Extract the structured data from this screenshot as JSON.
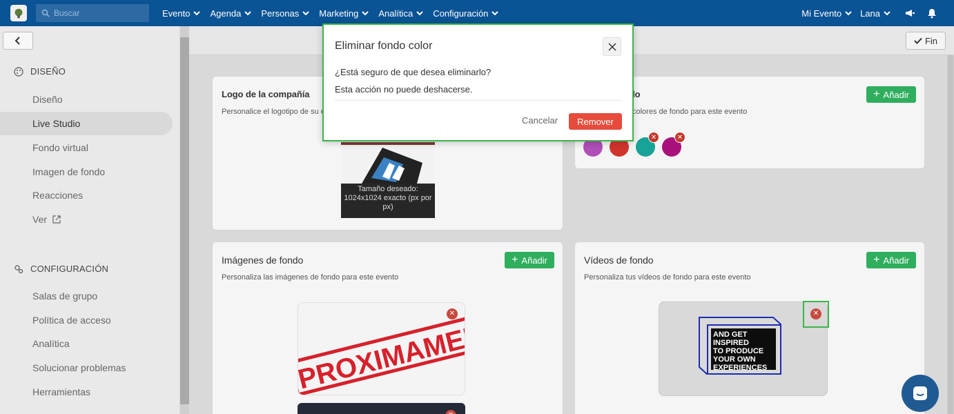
{
  "topbar": {
    "search_placeholder": "Buscar",
    "nav": [
      "Evento",
      "Agenda",
      "Personas",
      "Marketing",
      "Analítica",
      "Configuración"
    ],
    "event_menu": "Mi Evento",
    "user_menu": "Lana",
    "bg_color": "#0a5394"
  },
  "sidebar": {
    "section_design": "DISEÑO",
    "design_items": [
      "Diseño",
      "Live Studio",
      "Fondo virtual",
      "Imagen de fondo",
      "Reacciones",
      "Ver"
    ],
    "active_item": "Live Studio",
    "section_config": "CONFIGURACIÓN",
    "config_items": [
      "Salas de grupo",
      "Política de acceso",
      "Analítica",
      "Solucionar problemas",
      "Herramientas"
    ]
  },
  "main": {
    "fin_label": "Fin",
    "cards": {
      "logo": {
        "title": "Logo de la compañía",
        "subtitle": "Personalice el logotipo de su e",
        "caption": "Tamaño deseado: 1024x1024 exacto (px por px)"
      },
      "colors": {
        "title": "ndo",
        "subtitle": "colores de fondo para este evento",
        "add_label": "Añadir",
        "swatches": [
          "#b04fb8",
          "#d0342c",
          "#17a398",
          "#a8127a"
        ]
      },
      "images": {
        "title": "Imágenes de fondo",
        "subtitle": "Personaliza las imágenes de fondo para este evento",
        "add_label": "Añadir",
        "stamp_text": "PROXIMAMENTE"
      },
      "videos": {
        "title": "Vídeos de fondo",
        "subtitle": "Personaliza tus vídeos de fondo para este evento",
        "add_label": "Añadir",
        "video_text": "AND GET INSPIRED TO PRODUCE YOUR OWN EXPERIENCES"
      }
    }
  },
  "modal": {
    "title": "Eliminar fondo color",
    "question": "¿Está seguro de que desea eliminarlo?",
    "warning": "Esta acción no puede deshacerse.",
    "cancel_label": "Cancelar",
    "remove_label": "Remover"
  },
  "colors": {
    "accent_green": "#2fae5e",
    "danger": "#e64b3b",
    "highlight": "#3bb54a"
  }
}
